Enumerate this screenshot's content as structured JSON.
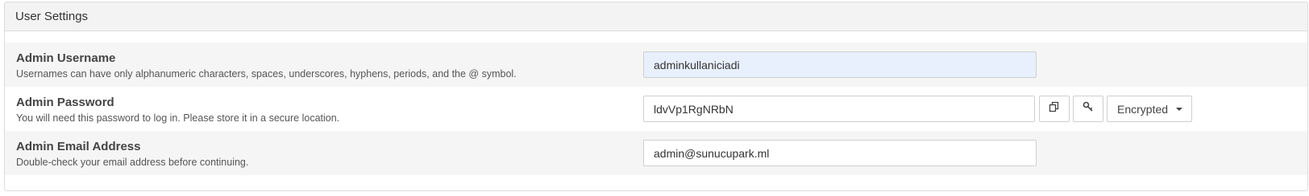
{
  "panel": {
    "title": "User Settings"
  },
  "fields": {
    "username": {
      "label": "Admin Username",
      "help": "Usernames can have only alphanumeric characters, spaces, underscores, hyphens, periods, and the @ symbol.",
      "value": "adminkullaniciadi"
    },
    "password": {
      "label": "Admin Password",
      "help": "You will need this password to log in. Please store it in a secure location.",
      "value": "ldvVp1RgNRbN",
      "copy_icon": "copy-icon",
      "key_icon": "key-icon",
      "mode_label": "Encrypted"
    },
    "email": {
      "label": "Admin Email Address",
      "help": "Double-check your email address before continuing.",
      "value": "admin@sunucupark.ml"
    }
  },
  "colors": {
    "header_bg": "#f3f3f3",
    "row_shade": "#f5f5f5",
    "autofill_bg": "#e8f0fe",
    "border": "#cfcfcf"
  }
}
